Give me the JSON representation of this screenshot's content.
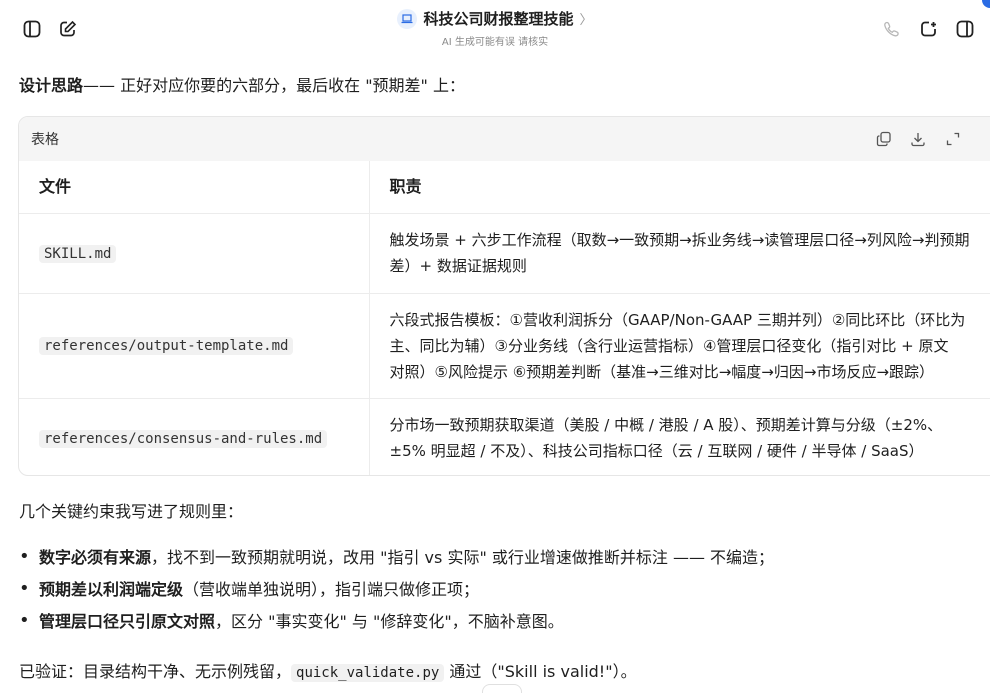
{
  "header": {
    "title": "科技公司财报整理技能",
    "chevron": "〉",
    "subtitle": "AI 生成可能有误 请核实"
  },
  "intro": {
    "bold": "设计思路",
    "rest": "—— 正好对应你要的六部分，最后收在 \"预期差\" 上："
  },
  "table": {
    "label": "表格",
    "headers": [
      "文件",
      "职责"
    ],
    "rows": [
      {
        "file": "SKILL.md",
        "lines": [
          "触发场景 + 六步工作流程（取数→一致预期→拆业务线→读管理层口径→列风险→判预期",
          "差）+ 数据证据规则"
        ]
      },
      {
        "file": "references/output-template.md",
        "lines": [
          "六段式报告模板：①营收利润拆分（GAAP/Non-GAAP 三期并列）②同比环比（环比为",
          "主、同比为辅）③分业务线（含行业运营指标）④管理层口径变化（指引对比 + 原文",
          "对照）⑤风险提示 ⑥预期差判断（基准→三维对比→幅度→归因→市场反应→跟踪）"
        ]
      },
      {
        "file": "references/consensus-and-rules.md",
        "lines": [
          "分市场一致预期获取渠道（美股 / 中概 / 港股 / A 股）、预期差计算与分级（±2%、",
          "±5% 明显超 / 不及）、科技公司指标口径（云 / 互联网 / 硬件 / 半导体 / SaaS）"
        ]
      }
    ]
  },
  "constraints_intro": "几个关键约束我写进了规则里：",
  "bullets": [
    {
      "bold": "数字必须有来源",
      "rest": "，找不到一致预期就明说，改用 \"指引 vs 实际\" 或行业增速做推断并标注 —— 不编造；"
    },
    {
      "bold": "预期差以利润端定级",
      "rest": "（营收端单独说明），指引端只做修正项；"
    },
    {
      "bold": "管理层口径只引原文对照",
      "rest": "，区分 \"事实变化\" 与 \"修辞变化\"，不脑补意图。"
    }
  ],
  "verified": {
    "prefix": "已验证：目录结构干净、无示例残留，",
    "code": "quick_validate.py",
    "suffix": " 通过（\"Skill is valid!\"）。"
  },
  "colors": {
    "accent": "#2b6ce4",
    "table_header_bg": "#f5f5f5",
    "code_bg": "#f1f1f1"
  },
  "icons": [
    "sidebar-toggle-icon",
    "new-chat-icon",
    "laptop-icon",
    "phone-icon",
    "new-window-icon",
    "panel-icon",
    "copy-icon",
    "download-icon",
    "expand-icon"
  ]
}
